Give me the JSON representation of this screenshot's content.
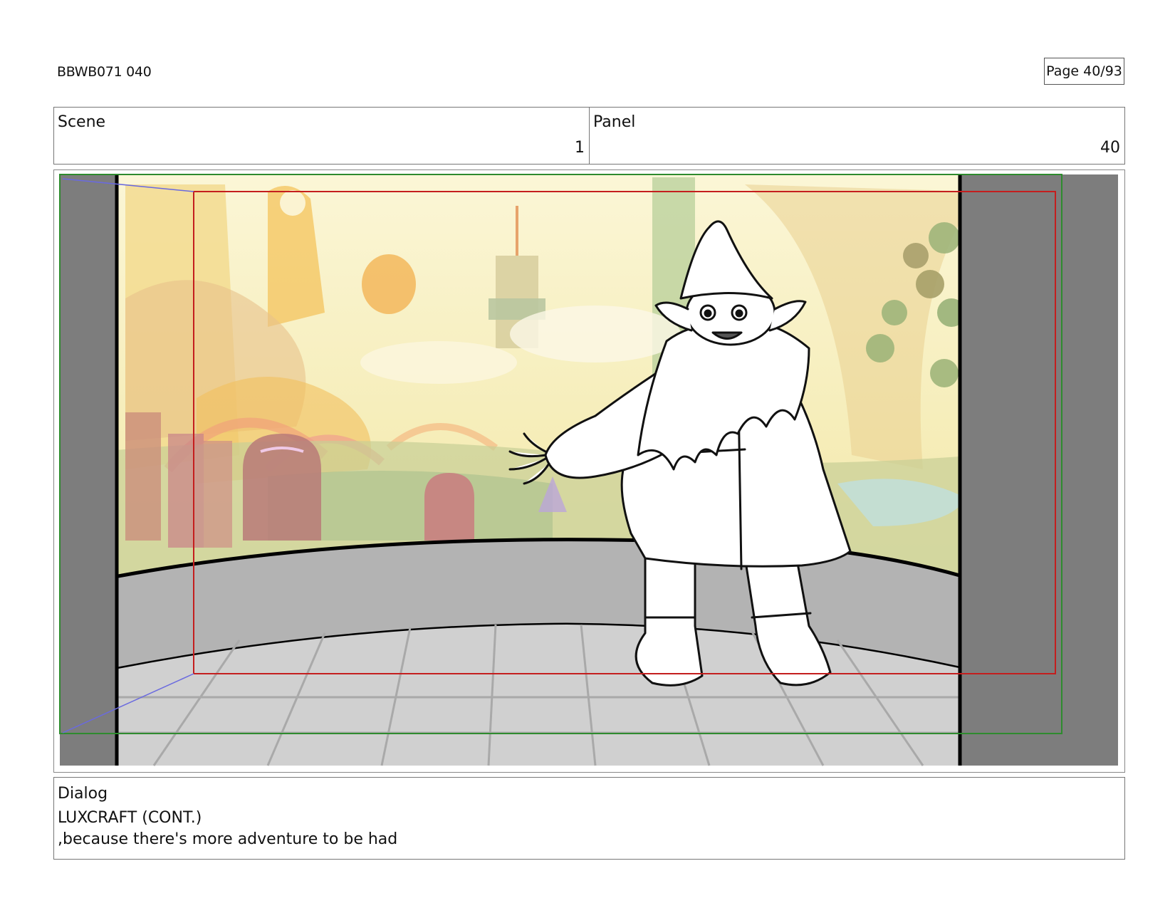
{
  "header": {
    "doc_id": "BBWB071 040",
    "page": "Page 40/93"
  },
  "info": {
    "scene_label": "Scene",
    "scene_value": "1",
    "panel_label": "Panel",
    "panel_value": "40"
  },
  "dialog": {
    "label": "Dialog",
    "speaker": "LUXCRAFT (CONT.)",
    "line": ",because there's more adventure to be had"
  },
  "colors": {
    "safe_frame": "#c41e1e",
    "camera_frame": "#2e8b2e",
    "letterbox": "#7d7d7d",
    "wall": "#b3b3b3",
    "floor": "#d0d0d0"
  }
}
